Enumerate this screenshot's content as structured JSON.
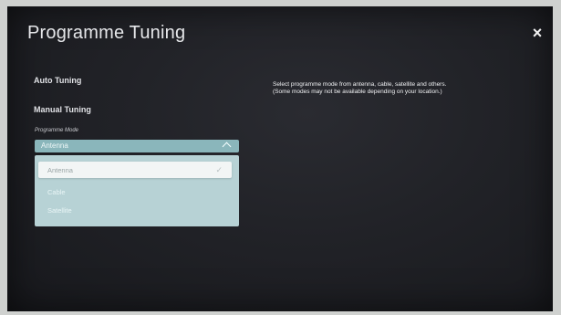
{
  "header": {
    "title": "Programme Tuning",
    "close_symbol": "×"
  },
  "menu": {
    "auto_tuning": "Auto Tuning",
    "manual_tuning": "Manual Tuning"
  },
  "programme_mode": {
    "label": "Programme Mode",
    "selected": "Antenna",
    "options": [
      "Antenna",
      "Cable",
      "Satellite"
    ],
    "check_symbol": "✓"
  },
  "description": {
    "line1": "Select programme mode from antenna, cable, satellite and others.",
    "line2": "(Some modes may not be available depending on your location.)"
  },
  "colors": {
    "accent": "#8ab6bb",
    "dropdown_bg": "#b7d2d5",
    "background": "#212227"
  }
}
